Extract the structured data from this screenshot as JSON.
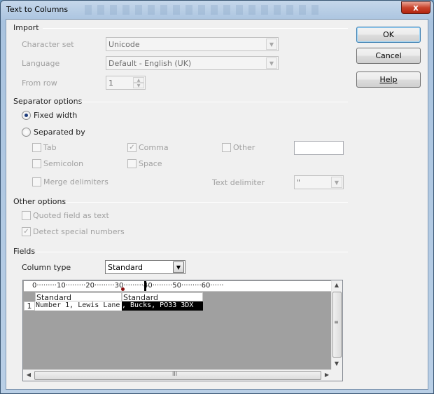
{
  "window": {
    "title": "Text to Columns",
    "close_label": "x"
  },
  "import": {
    "heading": "Import",
    "charset_label": "Character set",
    "charset_value": "Unicode",
    "language_label": "Language",
    "language_value": "Default - English (UK)",
    "from_row_label": "From row",
    "from_row_value": "1"
  },
  "buttons": {
    "ok": "OK",
    "cancel": "Cancel",
    "help": "Help"
  },
  "separator": {
    "heading": "Separator options",
    "fixed_width": "Fixed width",
    "separated_by": "Separated by",
    "tab": "Tab",
    "comma": "Comma",
    "other": "Other",
    "semicolon": "Semicolon",
    "space": "Space",
    "merge": "Merge delimiters",
    "text_delim_label": "Text delimiter",
    "text_delim_value": "\""
  },
  "other_options": {
    "heading": "Other options",
    "quoted": "Quoted field as text",
    "detect": "Detect special numbers"
  },
  "fields": {
    "heading": "Fields",
    "column_type_label": "Column type",
    "column_type_value": "Standard",
    "ruler": "0·········10·········20·········30·········40·········50·········60······",
    "col1_header": "Standard",
    "col2_header": "Standard",
    "row_number": "1",
    "row_text_a": "Number 1, Lewis Lane",
    "row_text_b": ", Bucks, PO33 3DX",
    "scroll_mid": "≡",
    "hscroll_mid": "III"
  }
}
